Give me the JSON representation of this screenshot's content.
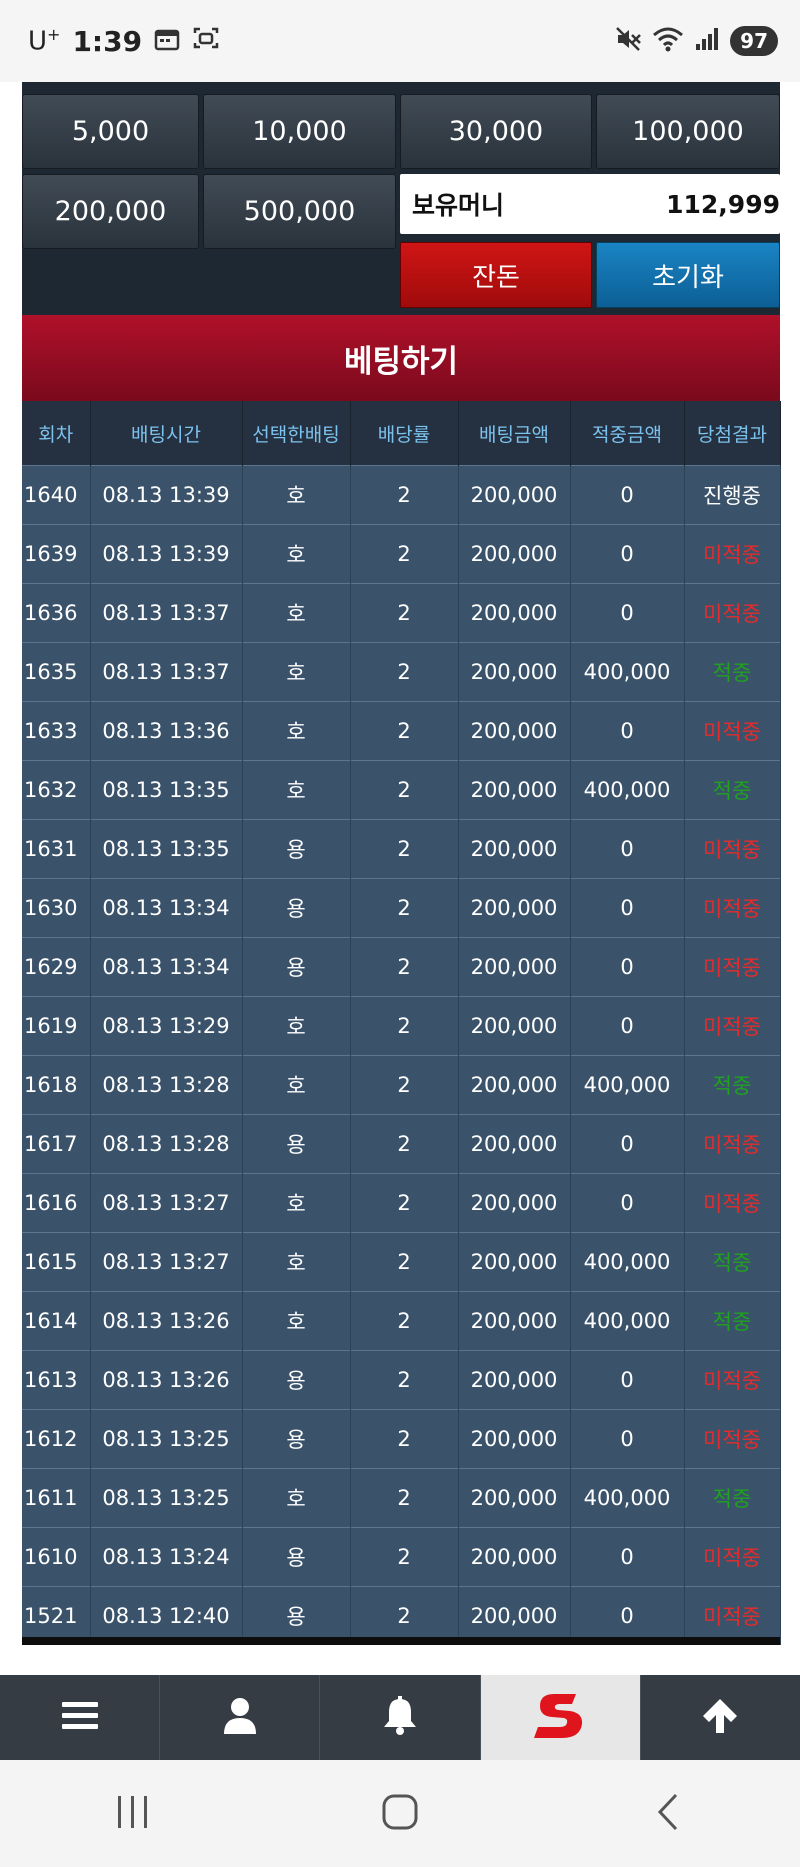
{
  "status_bar": {
    "carrier": "U",
    "carrier_sup": "+",
    "time": "1:39",
    "battery": "97"
  },
  "bet_amounts": [
    "5,000",
    "10,000",
    "30,000",
    "100,000",
    "200,000",
    "500,000"
  ],
  "balance": {
    "label": "보유머니",
    "value": "112,999"
  },
  "buttons": {
    "jandon": "잔돈",
    "reset": "초기화",
    "place_bet": "베팅하기"
  },
  "history": {
    "headers": [
      "회차",
      "배팅시간",
      "선택한배팅",
      "배당률",
      "배팅금액",
      "적중금액",
      "당첨결과"
    ],
    "rows": [
      {
        "round": "1640",
        "time": "08.13 13:39",
        "pick": "호",
        "odds": "2",
        "amount": "200,000",
        "win": "0",
        "result": "진행중",
        "status": "prog"
      },
      {
        "round": "1639",
        "time": "08.13 13:39",
        "pick": "호",
        "odds": "2",
        "amount": "200,000",
        "win": "0",
        "result": "미적중",
        "status": "lose"
      },
      {
        "round": "1636",
        "time": "08.13 13:37",
        "pick": "호",
        "odds": "2",
        "amount": "200,000",
        "win": "0",
        "result": "미적중",
        "status": "lose"
      },
      {
        "round": "1635",
        "time": "08.13 13:37",
        "pick": "호",
        "odds": "2",
        "amount": "200,000",
        "win": "400,000",
        "result": "적중",
        "status": "win"
      },
      {
        "round": "1633",
        "time": "08.13 13:36",
        "pick": "호",
        "odds": "2",
        "amount": "200,000",
        "win": "0",
        "result": "미적중",
        "status": "lose"
      },
      {
        "round": "1632",
        "time": "08.13 13:35",
        "pick": "호",
        "odds": "2",
        "amount": "200,000",
        "win": "400,000",
        "result": "적중",
        "status": "win"
      },
      {
        "round": "1631",
        "time": "08.13 13:35",
        "pick": "용",
        "odds": "2",
        "amount": "200,000",
        "win": "0",
        "result": "미적중",
        "status": "lose"
      },
      {
        "round": "1630",
        "time": "08.13 13:34",
        "pick": "용",
        "odds": "2",
        "amount": "200,000",
        "win": "0",
        "result": "미적중",
        "status": "lose"
      },
      {
        "round": "1629",
        "time": "08.13 13:34",
        "pick": "용",
        "odds": "2",
        "amount": "200,000",
        "win": "0",
        "result": "미적중",
        "status": "lose"
      },
      {
        "round": "1619",
        "time": "08.13 13:29",
        "pick": "호",
        "odds": "2",
        "amount": "200,000",
        "win": "0",
        "result": "미적중",
        "status": "lose"
      },
      {
        "round": "1618",
        "time": "08.13 13:28",
        "pick": "호",
        "odds": "2",
        "amount": "200,000",
        "win": "400,000",
        "result": "적중",
        "status": "win"
      },
      {
        "round": "1617",
        "time": "08.13 13:28",
        "pick": "용",
        "odds": "2",
        "amount": "200,000",
        "win": "0",
        "result": "미적중",
        "status": "lose"
      },
      {
        "round": "1616",
        "time": "08.13 13:27",
        "pick": "호",
        "odds": "2",
        "amount": "200,000",
        "win": "0",
        "result": "미적중",
        "status": "lose"
      },
      {
        "round": "1615",
        "time": "08.13 13:27",
        "pick": "호",
        "odds": "2",
        "amount": "200,000",
        "win": "400,000",
        "result": "적중",
        "status": "win"
      },
      {
        "round": "1614",
        "time": "08.13 13:26",
        "pick": "호",
        "odds": "2",
        "amount": "200,000",
        "win": "400,000",
        "result": "적중",
        "status": "win"
      },
      {
        "round": "1613",
        "time": "08.13 13:26",
        "pick": "용",
        "odds": "2",
        "amount": "200,000",
        "win": "0",
        "result": "미적중",
        "status": "lose"
      },
      {
        "round": "1612",
        "time": "08.13 13:25",
        "pick": "용",
        "odds": "2",
        "amount": "200,000",
        "win": "0",
        "result": "미적중",
        "status": "lose"
      },
      {
        "round": "1611",
        "time": "08.13 13:25",
        "pick": "호",
        "odds": "2",
        "amount": "200,000",
        "win": "400,000",
        "result": "적중",
        "status": "win"
      },
      {
        "round": "1610",
        "time": "08.13 13:24",
        "pick": "용",
        "odds": "2",
        "amount": "200,000",
        "win": "0",
        "result": "미적중",
        "status": "lose"
      },
      {
        "round": "1521",
        "time": "08.13 12:40",
        "pick": "용",
        "odds": "2",
        "amount": "200,000",
        "win": "0",
        "result": "미적중",
        "status": "lose"
      }
    ]
  },
  "colors": {
    "lose": "#e52b2b",
    "win": "#1fa21f",
    "header_text": "#7cc2ee",
    "banner": "#9a0c22"
  },
  "bottom_nav": [
    "menu-icon",
    "user-icon",
    "bell-icon",
    "site-logo",
    "arrow-up-icon"
  ]
}
